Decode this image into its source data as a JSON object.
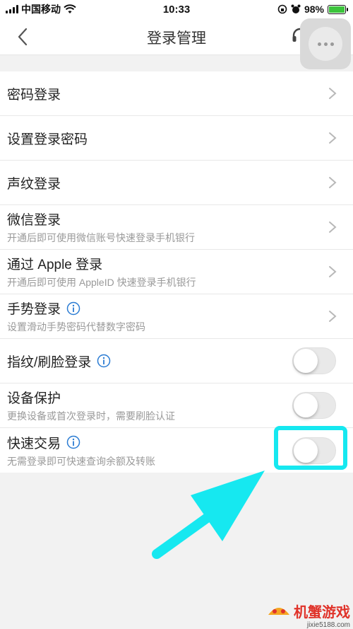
{
  "status_bar": {
    "carrier": "中国移动",
    "time": "10:33",
    "battery": "98%",
    "battery_level": 0.98
  },
  "nav": {
    "title": "登录管理"
  },
  "rows": [
    {
      "title": "密码登录",
      "control": "chevron"
    },
    {
      "title": "设置登录密码",
      "control": "chevron"
    },
    {
      "title": "声纹登录",
      "control": "chevron"
    },
    {
      "title": "微信登录",
      "subtitle": "开通后即可使用微信账号快速登录手机银行",
      "control": "chevron"
    },
    {
      "title": "通过 Apple 登录",
      "subtitle": "开通后即可使用 AppleID 快速登录手机银行",
      "control": "chevron"
    },
    {
      "title": "手势登录",
      "subtitle": "设置滑动手势密码代替数字密码",
      "control": "chevron",
      "info": true
    },
    {
      "title": "指纹/刷脸登录",
      "control": "toggle",
      "info": true,
      "on": false
    },
    {
      "title": "设备保护",
      "subtitle": "更换设备或首次登录时，需要刷脸认证",
      "control": "toggle",
      "on": false
    },
    {
      "title": "快速交易",
      "subtitle": "无需登录即可快速查询余额及转账",
      "control": "toggle",
      "info": true,
      "on": false
    }
  ],
  "annotation": {
    "color": "#16e8f0"
  },
  "watermark": {
    "name": "机蟹游戏",
    "url": "jixie5188.com"
  },
  "colors": {
    "accent_blue": "#2b7cd3",
    "chevron": "#b8b8b8",
    "page_bg": "#f2f2f2"
  }
}
